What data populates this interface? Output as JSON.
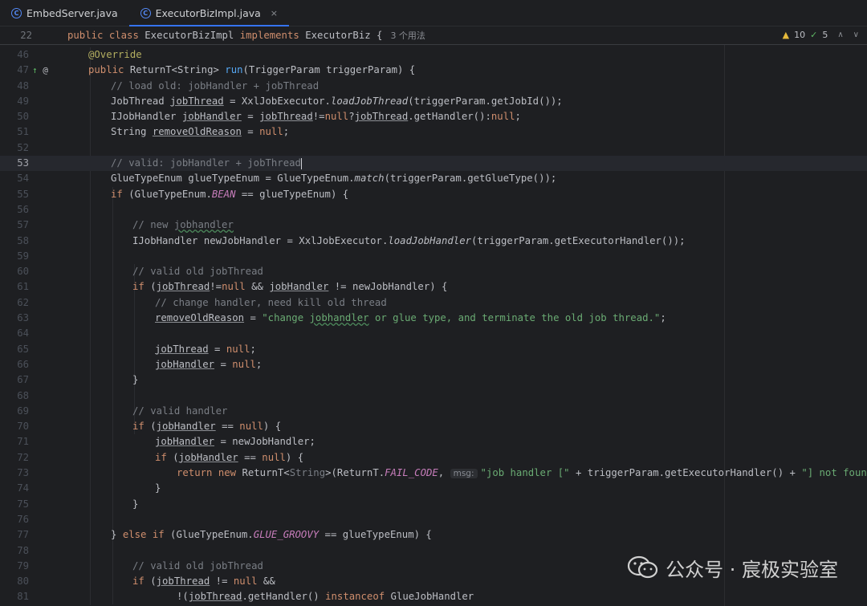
{
  "tabs": [
    {
      "label": "EmbedServer.java",
      "icon": "C",
      "active": false
    },
    {
      "label": "ExecutorBizImpl.java",
      "icon": "C",
      "active": true,
      "close": "×"
    }
  ],
  "sticky": {
    "line_no": "22",
    "kw1": "public",
    "kw2": "class",
    "name": "ExecutorBizImpl",
    "kw3": "implements",
    "iface": "ExecutorBiz {",
    "usages_hint": "3 个用法"
  },
  "inspections": {
    "warnings": "10",
    "ok": "5"
  },
  "code_lines": [
    {
      "n": "46"
    },
    {
      "n": "47"
    },
    {
      "n": "48"
    },
    {
      "n": "49"
    },
    {
      "n": "50"
    },
    {
      "n": "51"
    },
    {
      "n": "52"
    },
    {
      "n": "53"
    },
    {
      "n": "54"
    },
    {
      "n": "55"
    },
    {
      "n": "56"
    },
    {
      "n": "57"
    },
    {
      "n": "58"
    },
    {
      "n": "59"
    },
    {
      "n": "60"
    },
    {
      "n": "61"
    },
    {
      "n": "62"
    },
    {
      "n": "63"
    },
    {
      "n": "64"
    },
    {
      "n": "65"
    },
    {
      "n": "66"
    },
    {
      "n": "67"
    },
    {
      "n": "68"
    },
    {
      "n": "69"
    },
    {
      "n": "70"
    },
    {
      "n": "71"
    },
    {
      "n": "72"
    },
    {
      "n": "73"
    },
    {
      "n": "74"
    },
    {
      "n": "75"
    },
    {
      "n": "76"
    },
    {
      "n": "77"
    },
    {
      "n": "78"
    },
    {
      "n": "79"
    },
    {
      "n": "80"
    },
    {
      "n": "81"
    }
  ],
  "text": {
    "override": "@Override",
    "l47_kw": "public",
    "l47_type": "ReturnT<String>",
    "l47_fn": "run",
    "l47_rest": "(TriggerParam triggerParam) {",
    "l48": "// load old: jobHandler + jobThread",
    "l49_a": "JobThread",
    "l49_b": "jobThread",
    "l49_c": " = XxlJobExecutor.",
    "l49_d": "loadJobThread",
    "l49_e": "(triggerParam.getJobId());",
    "l50_a": "IJobHandler",
    "l50_b": "jobHandler",
    "l50_c": " = ",
    "l50_d": "jobThread",
    "l50_e": "!=",
    "l50_f": "null",
    "l50_g": "?",
    "l50_h": "jobThread",
    "l50_i": ".getHandler():",
    "l50_j": "null",
    "l50_k": ";",
    "l51_a": "String",
    "l51_b": "removeOldReason",
    "l51_c": " = ",
    "l51_d": "null",
    "l51_e": ";",
    "l53": "// valid: jobHandler + jobThread",
    "l54_a": "GlueTypeEnum glueTypeEnum = GlueTypeEnum.",
    "l54_b": "match",
    "l54_c": "(triggerParam.getGlueType());",
    "l55_a": "if",
    "l55_b": " (GlueTypeEnum.",
    "l55_c": "BEAN",
    "l55_d": " == glueTypeEnum) {",
    "l57_a": "// new ",
    "l57_b": "jobhandler",
    "l58_a": "IJobHandler newJobHandler = XxlJobExecutor.",
    "l58_b": "loadJobHandler",
    "l58_c": "(triggerParam.getExecutorHandler());",
    "l60": "// valid old jobThread",
    "l61_a": "if",
    "l61_b": " (",
    "l61_c": "jobThread",
    "l61_d": "!=",
    "l61_e": "null",
    "l61_f": " && ",
    "l61_g": "jobHandler",
    "l61_h": " != newJobHandler) {",
    "l62": "// change handler, need kill old thread",
    "l63_a": "removeOldReason",
    "l63_b": " = ",
    "l63_c": "\"change ",
    "l63_d": "jobhandler",
    "l63_e": " or glue type, and terminate the old job thread.\"",
    "l63_f": ";",
    "l65_a": "jobThread",
    "l65_b": " = ",
    "l65_c": "null",
    "l65_d": ";",
    "l66_a": "jobHandler",
    "l66_b": " = ",
    "l66_c": "null",
    "l66_d": ";",
    "brace": "}",
    "l69": "// valid handler",
    "l70_a": "if",
    "l70_b": " (",
    "l70_c": "jobHandler",
    "l70_d": " == ",
    "l70_e": "null",
    "l70_f": ") {",
    "l71_a": "jobHandler",
    "l71_b": " = newJobHandler;",
    "l72_a": "if",
    "l72_b": " (",
    "l72_c": "jobHandler",
    "l72_d": " == ",
    "l72_e": "null",
    "l72_f": ") {",
    "l73_a": "return",
    "l73_b": " ",
    "l73_c": "new",
    "l73_d": " ReturnT<",
    "l73_e": "String",
    "l73_f": ">(ReturnT.",
    "l73_g": "FAIL_CODE",
    "l73_h": ", ",
    "l73_hint": "msg:",
    "l73_i": "\"job handler [\"",
    "l73_j": " + triggerParam.getExecutorHandler() + ",
    "l73_k": "\"] not found.\"",
    "l73_l": ");",
    "l77_a": "} ",
    "l77_b": "else if",
    "l77_c": " (GlueTypeEnum.",
    "l77_d": "GLUE_GROOVY",
    "l77_e": " == glueTypeEnum) {",
    "l79": "// valid old jobThread",
    "l80_a": "if",
    "l80_b": " (",
    "l80_c": "jobThread",
    "l80_d": " != ",
    "l80_e": "null",
    "l80_f": " &&",
    "l81_a": "!(",
    "l81_b": "jobThread",
    "l81_c": ".getHandler() ",
    "l81_d": "instanceof",
    "l81_e": " GlueJobHandler"
  },
  "watermark": {
    "text": "公众号 · 宸极实验室"
  },
  "colors": {
    "background": "#1e1f22",
    "keyword": "#cf8e6d",
    "string": "#6aab73",
    "comment": "#7a7e85",
    "function": "#56a8f5",
    "accent": "#3574f0"
  }
}
